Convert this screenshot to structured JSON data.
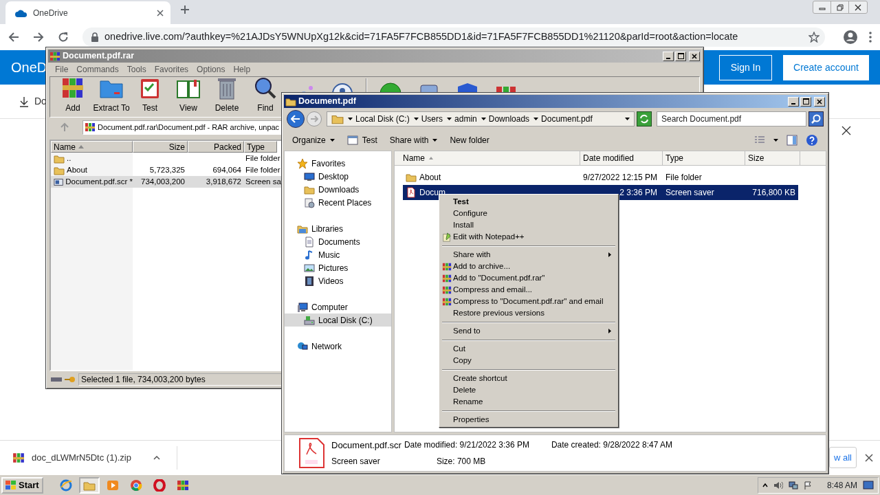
{
  "browser": {
    "tab": {
      "title": "OneDrive",
      "selected": true
    },
    "address": "onedrive.live.com/?authkey=%21AJDsY5WNUpXg12k&cid=71FA5F7FCB855DD1&id=71FA5F7FCB855DD1%21120&parId=root&action=locate",
    "site_header": {
      "logo": "OneD",
      "sign_in": "Sign In",
      "create_account": "Create account"
    },
    "command_bar": {
      "download": "Do"
    }
  },
  "download_bar": {
    "file": "doc_dLWMrN5Dtc (1).zip",
    "show_all": "w all"
  },
  "winrar": {
    "title": "Document.pdf.rar",
    "active": false,
    "menu": [
      "File",
      "Commands",
      "Tools",
      "Favorites",
      "Options",
      "Help"
    ],
    "toolbar": [
      "Add",
      "Extract To",
      "Test",
      "View",
      "Delete",
      "Find"
    ],
    "path": "Document.pdf.rar\\Document.pdf - RAR archive, unpac",
    "columns": [
      {
        "label": "Name",
        "sorted": true
      },
      {
        "label": "Size",
        "sorted": false
      },
      {
        "label": "Packed",
        "sorted": false
      },
      {
        "label": "Type",
        "sorted": false
      }
    ],
    "rows": [
      {
        "kind": "folder",
        "name": "..",
        "type": "File folder",
        "selected": false
      },
      {
        "kind": "folder",
        "name": "About",
        "size": "5,723,325",
        "packed": "694,064",
        "type": "File folder",
        "selected": false
      },
      {
        "kind": "file",
        "name": "Document.pdf.scr *",
        "size": "734,003,200",
        "packed": "3,918,672",
        "type": "Screen sa",
        "selected": true
      }
    ],
    "status": "Selected 1 file, 734,003,200 bytes"
  },
  "explorer": {
    "title": "Document.pdf",
    "active": true,
    "breadcrumb": [
      "Local Disk (C:)",
      "Users",
      "admin",
      "Downloads",
      "Document.pdf"
    ],
    "search": {
      "placeholder": "Search Document.pdf"
    },
    "toolbar": [
      {
        "label": "Organize",
        "dropdown": true
      },
      {
        "label": "Test",
        "dropdown": false
      },
      {
        "label": "Share with",
        "dropdown": true
      },
      {
        "label": "New folder",
        "dropdown": false
      }
    ],
    "nav": [
      {
        "label": "Favorites",
        "selected": false,
        "children": [
          {
            "label": "Desktop",
            "selected": false
          },
          {
            "label": "Downloads",
            "selected": false
          },
          {
            "label": "Recent Places",
            "selected": false
          }
        ]
      },
      {
        "label": "Libraries",
        "selected": false,
        "children": [
          {
            "label": "Documents",
            "selected": false
          },
          {
            "label": "Music",
            "selected": false
          },
          {
            "label": "Pictures",
            "selected": false
          },
          {
            "label": "Videos",
            "selected": false
          }
        ]
      },
      {
        "label": "Computer",
        "selected": false,
        "children": [
          {
            "label": "Local Disk (C:)",
            "selected": true
          }
        ]
      },
      {
        "label": "Network",
        "selected": false
      }
    ],
    "columns": [
      {
        "label": "Name",
        "sorted": true
      },
      {
        "label": "Date modified",
        "sorted": false
      },
      {
        "label": "Type",
        "sorted": false
      },
      {
        "label": "Size",
        "sorted": false
      }
    ],
    "files": [
      {
        "kind": "folder",
        "name": "About",
        "date": "9/27/2022 12:15 PM",
        "type": "File folder",
        "selected": false
      },
      {
        "kind": "pdf",
        "name": "Docum",
        "date": "2 3:36 PM",
        "type": "Screen saver",
        "size": "716,800 KB",
        "selected": true
      }
    ],
    "details": {
      "name": "Document.pdf.scr",
      "type": "Screen saver",
      "fields": [
        {
          "label": "Date modified:",
          "value": "9/21/2022 3:36 PM"
        },
        {
          "label": "Size:",
          "value": "700 MB"
        },
        {
          "label": "Date created:",
          "value": "9/28/2022 8:47 AM"
        }
      ]
    }
  },
  "context_menu": {
    "items": [
      {
        "kind": "item",
        "label": "Test",
        "default": true,
        "submenu": false
      },
      {
        "kind": "item",
        "label": "Configure",
        "default": false,
        "submenu": false
      },
      {
        "kind": "item",
        "label": "Install",
        "default": false,
        "submenu": false
      },
      {
        "kind": "item",
        "label": "Edit with Notepad++",
        "default": false,
        "submenu": false
      },
      {
        "kind": "separator"
      },
      {
        "kind": "item",
        "label": "Share with",
        "default": false,
        "submenu": true
      },
      {
        "kind": "item",
        "label": "Add to archive...",
        "default": false,
        "submenu": false
      },
      {
        "kind": "item",
        "label": "Add to \"Document.pdf.rar\"",
        "default": false,
        "submenu": false
      },
      {
        "kind": "item",
        "label": "Compress and email...",
        "default": false,
        "submenu": false
      },
      {
        "kind": "item",
        "label": "Compress to \"Document.pdf.rar\" and email",
        "default": false,
        "submenu": false
      },
      {
        "kind": "item",
        "label": "Restore previous versions",
        "default": false,
        "submenu": false
      },
      {
        "kind": "separator"
      },
      {
        "kind": "item",
        "label": "Send to",
        "default": false,
        "submenu": true
      },
      {
        "kind": "separator"
      },
      {
        "kind": "item",
        "label": "Cut",
        "default": false,
        "submenu": false
      },
      {
        "kind": "item",
        "label": "Copy",
        "default": false,
        "submenu": false
      },
      {
        "kind": "separator"
      },
      {
        "kind": "item",
        "label": "Create shortcut",
        "default": false,
        "submenu": false
      },
      {
        "kind": "item",
        "label": "Delete",
        "default": false,
        "submenu": false
      },
      {
        "kind": "item",
        "label": "Rename",
        "default": false,
        "submenu": false
      },
      {
        "kind": "separator"
      },
      {
        "kind": "item",
        "label": "Properties",
        "default": false,
        "submenu": false
      }
    ]
  },
  "taskbar": {
    "start": "Start",
    "apps": [
      {
        "selected": false
      },
      {
        "selected": true
      },
      {
        "selected": false
      },
      {
        "selected": false
      },
      {
        "selected": false
      },
      {
        "selected": false
      }
    ],
    "clock": "8:48 AM"
  }
}
